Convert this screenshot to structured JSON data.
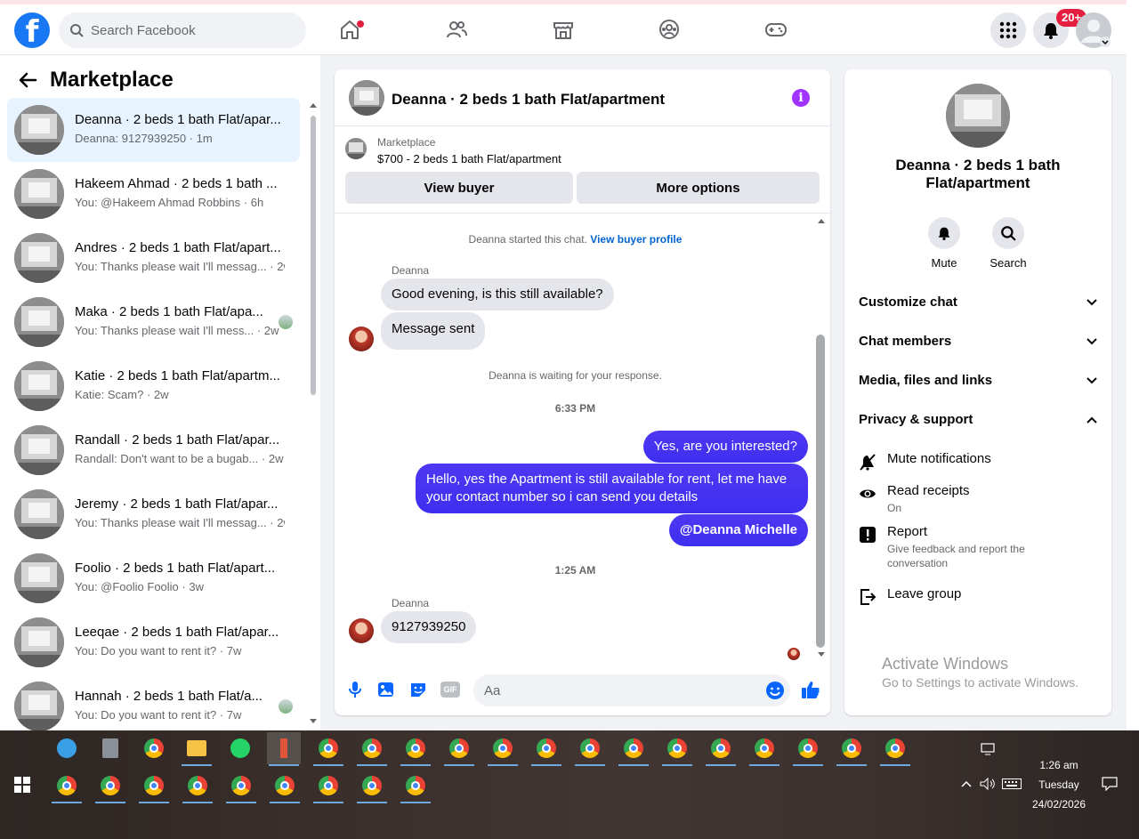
{
  "topbar": {
    "logo": "f",
    "search_placeholder": "Search Facebook",
    "notifications_badge": "20+",
    "nav_icons": [
      "home-icon",
      "friends-icon",
      "marketplace-icon",
      "groups-icon",
      "gaming-icon"
    ]
  },
  "marketplace": {
    "title": "Marketplace",
    "conversations": [
      {
        "name": "Deanna · 2 beds 1 bath Flat/apar...",
        "preview": "Deanna: 9127939250 · 1m",
        "active": true
      },
      {
        "name": "Hakeem Ahmad · 2 beds 1 bath ...",
        "preview": "You: @Hakeem Ahmad Robbins · 6h"
      },
      {
        "name": "Andres · 2 beds 1 bath Flat/apart...",
        "preview": "You: Thanks please wait I'll messag... · 2w"
      },
      {
        "name": "Maka · 2 beds 1 bath Flat/apa...",
        "preview": "You: Thanks please wait I'll mess... · 2w",
        "indicator": true
      },
      {
        "name": "Katie · 2 beds 1 bath Flat/apartm...",
        "preview": "Katie: Scam? · 2w"
      },
      {
        "name": "Randall · 2 beds 1 bath Flat/apar...",
        "preview": "Randall: Don't want to be a bugab... · 2w"
      },
      {
        "name": "Jeremy · 2 beds 1 bath Flat/apar...",
        "preview": "You: Thanks please wait I'll messag... · 2w"
      },
      {
        "name": "Foolio · 2 beds 1 bath Flat/apart...",
        "preview": "You: @Foolio Foolio · 3w"
      },
      {
        "name": "Leeqae · 2 beds 1 bath Flat/apar...",
        "preview": "You: Do you want to rent it? · 7w"
      },
      {
        "name": "Hannah · 2 beds 1 bath Flat/a...",
        "preview": "You: Do you want to rent it? · 7w",
        "indicator": true
      }
    ]
  },
  "chat": {
    "header_title": "Deanna · 2 beds 1 bath Flat/apartment",
    "listing_label": "Marketplace",
    "listing_title": "$700 - 2 beds 1 bath Flat/apartment",
    "view_buyer": "View buyer",
    "more_options": "More options",
    "started_text": "Deanna started this chat.",
    "view_profile_link": "View buyer profile",
    "sender_name": "Deanna",
    "msg_in_1": "Good evening, is this still available?",
    "msg_in_2": "Message sent",
    "waiting_text": "Deanna is waiting for your response.",
    "time_1": "6:33 PM",
    "msg_out_1": "Yes, are you interested?",
    "msg_out_2": "Hello, yes the Apartment is still available for rent, let me have your contact number so i can send you details",
    "msg_out_3": "@Deanna Michelle",
    "time_2": "1:25 AM",
    "sender_name_2": "Deanna",
    "msg_in_3": "9127939250",
    "composer_placeholder": "Aa",
    "gif_label": "GIF"
  },
  "details": {
    "title": "Deanna · 2 beds 1 bath Flat/apartment",
    "mute": "Mute",
    "search": "Search",
    "customize": "Customize chat",
    "members": "Chat members",
    "media": "Media, files and links",
    "privacy": "Privacy & support",
    "mute_notifications": "Mute notifications",
    "read_receipts": "Read receipts",
    "read_receipts_value": "On",
    "report": "Report",
    "report_sub": "Give feedback and report the conversation",
    "leave": "Leave group"
  },
  "watermark": {
    "line1": "Activate Windows",
    "line2": "Go to Settings to activate Windows."
  },
  "taskbar": {
    "time": "1:26 am",
    "day": "Tuesday",
    "date": "24/02/2026"
  },
  "colors": {
    "facebook_blue": "#1877f2",
    "outgoing_bubble": "#3f2ef2",
    "badge_red": "#e41e3f",
    "info_purple": "#a033ff"
  }
}
